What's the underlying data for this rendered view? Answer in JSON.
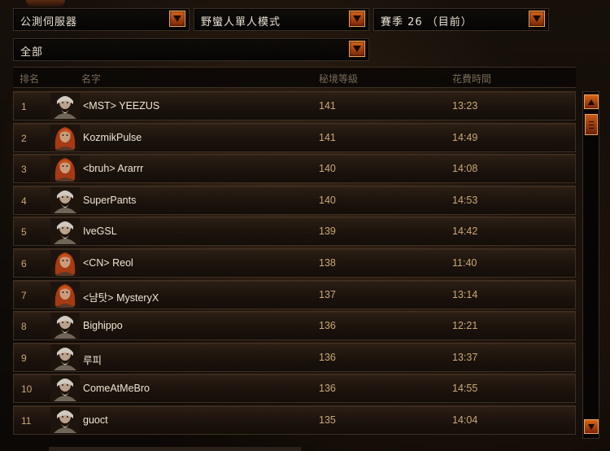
{
  "filters": {
    "server": "公測伺服器",
    "mode": "野蠻人單人模式",
    "season": "賽季 26 （目前）",
    "category": "全部"
  },
  "columns": {
    "rank": "排名",
    "name": "名字",
    "level": "秘境等級",
    "time": "花費時間"
  },
  "rows": [
    {
      "rank": "1",
      "name": "<MST> YEEZUS",
      "level": "141",
      "time": "13:23",
      "portrait": "old-barbarian"
    },
    {
      "rank": "2",
      "name": "KozmikPulse",
      "level": "141",
      "time": "14:49",
      "portrait": "red-hair-barbarian"
    },
    {
      "rank": "3",
      "name": "<bruh> Ararrr",
      "level": "140",
      "time": "14:08",
      "portrait": "red-hair-barbarian"
    },
    {
      "rank": "4",
      "name": "SuperPants",
      "level": "140",
      "time": "14:53",
      "portrait": "old-barbarian"
    },
    {
      "rank": "5",
      "name": "IveGSL",
      "level": "139",
      "time": "14:42",
      "portrait": "old-barbarian"
    },
    {
      "rank": "6",
      "name": "<CN> Reol",
      "level": "138",
      "time": "11:40",
      "portrait": "red-hair-barbarian"
    },
    {
      "rank": "7",
      "name": "<냠탓> MysteryX",
      "level": "137",
      "time": "13:14",
      "portrait": "red-hair-barbarian"
    },
    {
      "rank": "8",
      "name": "Bighippo",
      "level": "136",
      "time": "12:21",
      "portrait": "old-barbarian"
    },
    {
      "rank": "9",
      "name": "루피",
      "level": "136",
      "time": "13:37",
      "portrait": "old-barbarian"
    },
    {
      "rank": "10",
      "name": "ComeAtMeBro",
      "level": "136",
      "time": "14:55",
      "portrait": "old-barbarian"
    },
    {
      "rank": "11",
      "name": "guoct",
      "level": "135",
      "time": "14:04",
      "portrait": "old-barbarian"
    }
  ],
  "colors": {
    "accent": "#d9651c",
    "text_value": "#c9a877",
    "text_name": "#f0e6d2"
  }
}
